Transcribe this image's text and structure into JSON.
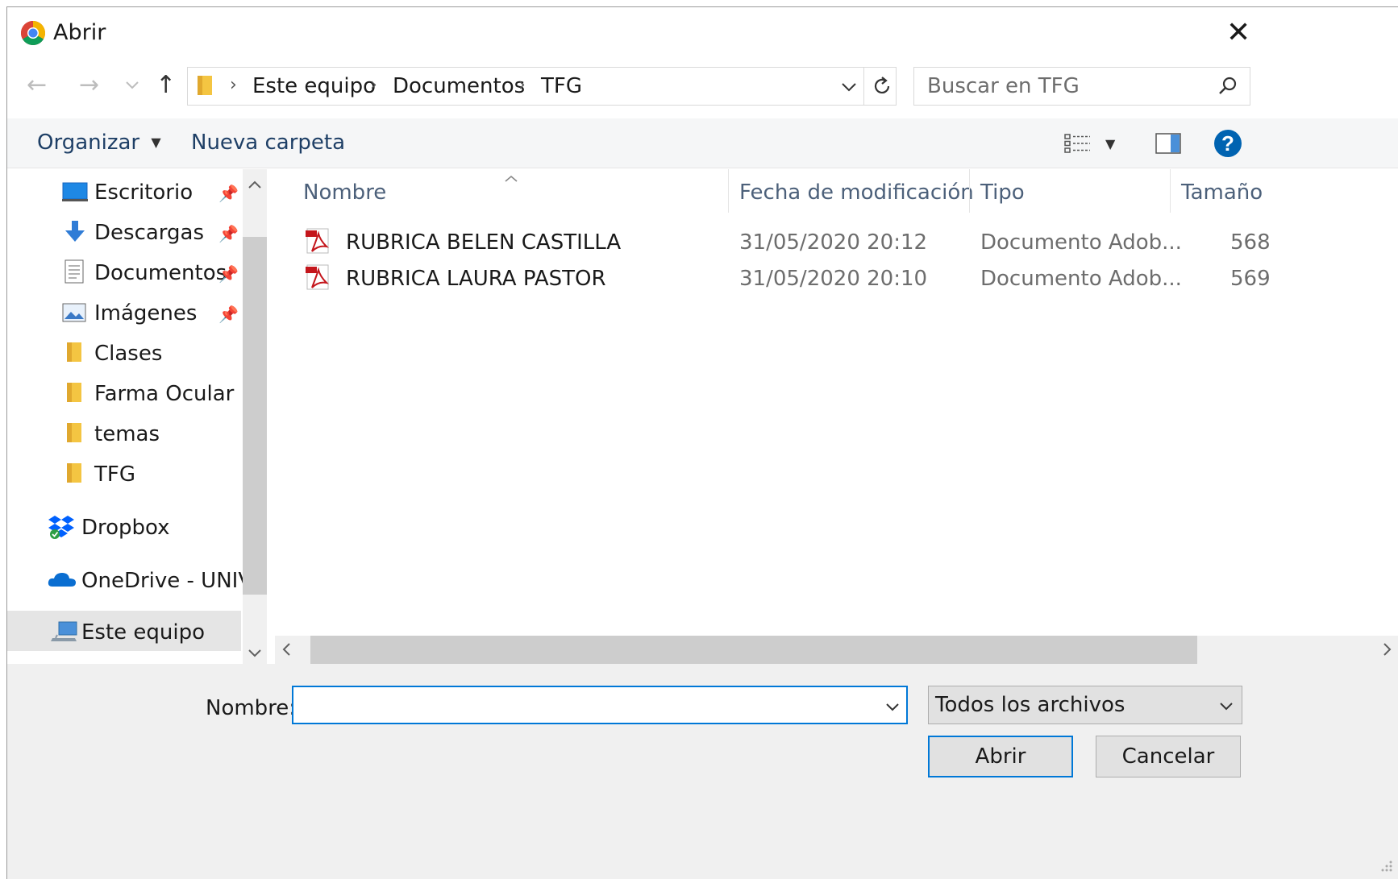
{
  "dialog": {
    "title": "Abrir"
  },
  "nav": {
    "back": "←",
    "forward": "→",
    "recent": "⌄",
    "up": "↑",
    "breadcrumbs": [
      "Este equipo",
      "Documentos",
      "TFG"
    ],
    "search_placeholder": "Buscar en TFG"
  },
  "toolbar": {
    "organize_label": "Organizar",
    "new_folder_label": "Nueva carpeta"
  },
  "sidebar": {
    "items": [
      {
        "label": "Escritorio",
        "icon": "desktop-icon",
        "pinned": true
      },
      {
        "label": "Descargas",
        "icon": "download-icon",
        "pinned": true
      },
      {
        "label": "Documentos",
        "icon": "document-icon",
        "pinned": true
      },
      {
        "label": "Imágenes",
        "icon": "pictures-icon",
        "pinned": true
      },
      {
        "label": "Clases",
        "icon": "folder-icon",
        "pinned": false
      },
      {
        "label": "Farma Ocular",
        "icon": "folder-icon",
        "pinned": false
      },
      {
        "label": "temas",
        "icon": "folder-icon",
        "pinned": false
      },
      {
        "label": "TFG",
        "icon": "folder-icon",
        "pinned": false
      },
      {
        "label": "Dropbox",
        "icon": "dropbox-icon",
        "pinned": false
      },
      {
        "label": "OneDrive - UNIVE",
        "icon": "onedrive-icon",
        "pinned": false
      },
      {
        "label": "Este equipo",
        "icon": "computer-icon",
        "pinned": false,
        "selected": true
      }
    ]
  },
  "files": {
    "columns": [
      "Nombre",
      "Fecha de modificación",
      "Tipo",
      "Tamaño"
    ],
    "rows": [
      {
        "name": "RUBRICA BELEN CASTILLA",
        "date": "31/05/2020 20:12",
        "type": "Documento Adob...",
        "size": "568"
      },
      {
        "name": "RUBRICA LAURA PASTOR",
        "date": "31/05/2020 20:10",
        "type": "Documento Adob...",
        "size": "569"
      }
    ]
  },
  "footer": {
    "name_label": "Nombre:",
    "name_value": "",
    "filetype_value": "Todos los archivos",
    "open_label": "Abrir",
    "cancel_label": "Cancelar"
  },
  "colors": {
    "accent": "#0078d7",
    "help": "#0063b1",
    "folder": "#f4c542",
    "pdf": "#c4161c"
  }
}
